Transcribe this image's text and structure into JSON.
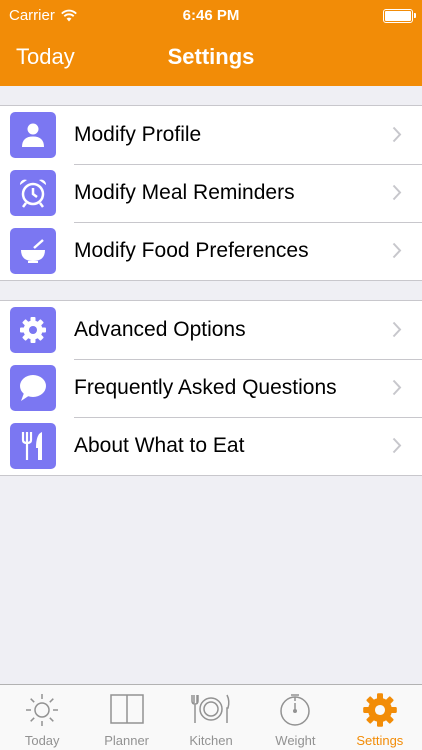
{
  "status_bar": {
    "carrier": "Carrier",
    "time": "6:46 PM"
  },
  "nav": {
    "back_label": "Today",
    "title": "Settings"
  },
  "groups": [
    [
      {
        "label": "Modify Profile",
        "icon": "profile-icon"
      },
      {
        "label": "Modify Meal Reminders",
        "icon": "alarm-clock-icon"
      },
      {
        "label": "Modify Food Preferences",
        "icon": "bowl-icon"
      }
    ],
    [
      {
        "label": "Advanced Options",
        "icon": "gear-icon"
      },
      {
        "label": "Frequently Asked Questions",
        "icon": "speech-bubble-icon"
      },
      {
        "label": "About What to Eat",
        "icon": "fork-knife-icon"
      }
    ]
  ],
  "tabs": [
    {
      "label": "Today",
      "icon": "sun-icon",
      "active": false
    },
    {
      "label": "Planner",
      "icon": "book-icon",
      "active": false
    },
    {
      "label": "Kitchen",
      "icon": "plate-cutlery-icon",
      "active": false
    },
    {
      "label": "Weight",
      "icon": "scale-icon",
      "active": false
    },
    {
      "label": "Settings",
      "icon": "gear-icon",
      "active": true
    }
  ],
  "colors": {
    "accent": "#f28c07",
    "icon_tile": "#7b77f2",
    "background": "#efeff4",
    "tab_inactive": "#929292"
  }
}
